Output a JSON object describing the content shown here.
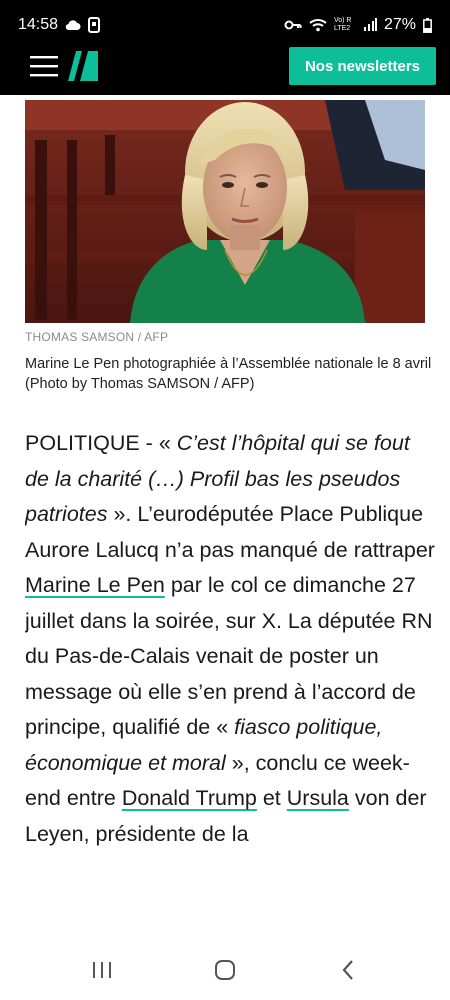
{
  "status_bar": {
    "time": "14:58",
    "network": "Vo) R LTE2",
    "battery": "27%",
    "icons": [
      "cloud-icon",
      "phone-screen-icon",
      "key-icon",
      "wifi-icon",
      "signal-icon",
      "battery-icon"
    ]
  },
  "header": {
    "menu_icon": "hamburger-icon",
    "logo_icon": "huffpost-logo",
    "newsletter_button": "Nos newsletters",
    "brand_color": "#0dbe98",
    "bar_color": "#000000"
  },
  "media": {
    "credit": "THOMAS SAMSON / AFP",
    "caption": "Marine Le Pen photographiée à l’Assemblée nationale le 8 avril (Photo by Thomas SAMSON / AFP)"
  },
  "article": {
    "section": "POLITIQUE - ",
    "quote1_open": "« ",
    "quote1": "C’est l’hôpital qui se fout de la charité (…) Profil bas les pseudos patriotes",
    "quote1_close": " »",
    "text1": ". L’eurodéputée Place Publique Aurore Lalucq n’a pas manqué de rattraper ",
    "link1": "Marine Le Pen",
    "text2": " par le col ce dimanche 27 juillet dans la soirée, sur X. La députée RN du Pas-de-Calais venait de poster un message où elle s’en prend à l’accord de principe, qualifié de ",
    "quote2_open": "« ",
    "quote2": "fiasco politique, économique et moral",
    "quote2_close": " »",
    "text3": ", conclu ce week-end entre ",
    "link2": "Donald Trump",
    "text4": " et ",
    "link3": "Ursula",
    "text5": " von der Leyen, présidente de la",
    "link_underline_color": "#0dbe98"
  },
  "nav_bar": {
    "icons": [
      "recent-apps-icon",
      "home-icon",
      "back-icon"
    ]
  }
}
